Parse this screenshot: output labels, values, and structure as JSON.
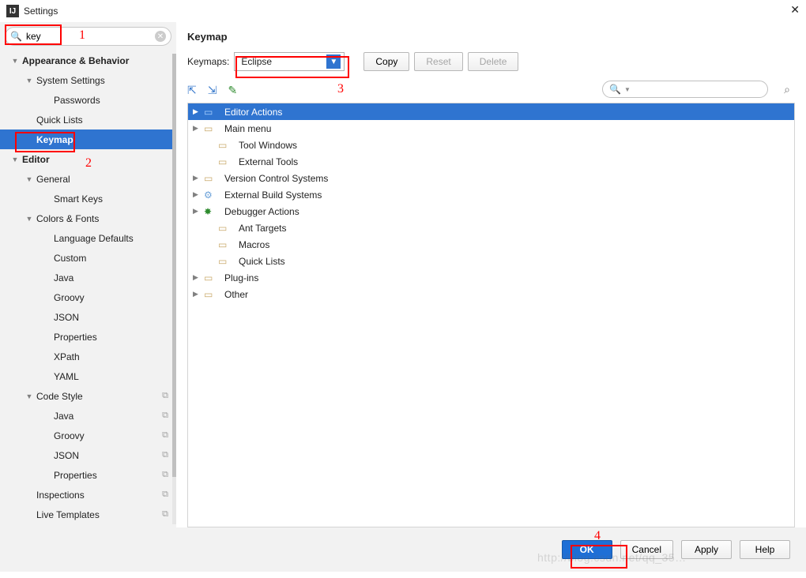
{
  "window": {
    "title": "Settings"
  },
  "search": {
    "value": "key"
  },
  "annotations": {
    "n1": "1",
    "n2": "2",
    "n3": "3",
    "n4": "4"
  },
  "sidebar": [
    {
      "label": "Appearance & Behavior",
      "level": 0,
      "arrow": "▼",
      "bold": true
    },
    {
      "label": "System Settings",
      "level": 1,
      "arrow": "▼"
    },
    {
      "label": "Passwords",
      "level": 2
    },
    {
      "label": "Quick Lists",
      "level": 1
    },
    {
      "label": "Keymap",
      "level": 1,
      "selected": true
    },
    {
      "label": "Editor",
      "level": 0,
      "arrow": "▼",
      "bold": true
    },
    {
      "label": "General",
      "level": 1,
      "arrow": "▼"
    },
    {
      "label": "Smart Keys",
      "level": 2
    },
    {
      "label": "Colors & Fonts",
      "level": 1,
      "arrow": "▼"
    },
    {
      "label": "Language Defaults",
      "level": 2
    },
    {
      "label": "Custom",
      "level": 2
    },
    {
      "label": "Java",
      "level": 2
    },
    {
      "label": "Groovy",
      "level": 2
    },
    {
      "label": "JSON",
      "level": 2
    },
    {
      "label": "Properties",
      "level": 2
    },
    {
      "label": "XPath",
      "level": 2
    },
    {
      "label": "YAML",
      "level": 2
    },
    {
      "label": "Code Style",
      "level": 1,
      "arrow": "▼",
      "copy": true
    },
    {
      "label": "Java",
      "level": 2,
      "copy": true
    },
    {
      "label": "Groovy",
      "level": 2,
      "copy": true
    },
    {
      "label": "JSON",
      "level": 2,
      "copy": true
    },
    {
      "label": "Properties",
      "level": 2,
      "copy": true
    },
    {
      "label": "Inspections",
      "level": 1,
      "copy": true
    },
    {
      "label": "Live Templates",
      "level": 1,
      "copy": true
    }
  ],
  "page": {
    "title": "Keymap",
    "keymaps_label": "Keymaps:",
    "selected_keymap": "Eclipse",
    "copy": "Copy",
    "reset": "Reset",
    "delete": "Delete"
  },
  "actions": [
    {
      "label": "Editor Actions",
      "arrow": "▶",
      "iconType": "folder",
      "selected": true
    },
    {
      "label": "Main menu",
      "arrow": "▶",
      "iconType": "folder"
    },
    {
      "label": "Tool Windows",
      "iconType": "folder",
      "indent": true
    },
    {
      "label": "External Tools",
      "iconType": "folder",
      "indent": true
    },
    {
      "label": "Version Control Systems",
      "arrow": "▶",
      "iconType": "folder"
    },
    {
      "label": "External Build Systems",
      "arrow": "▶",
      "iconType": "ext"
    },
    {
      "label": "Debugger Actions",
      "arrow": "▶",
      "iconType": "bug"
    },
    {
      "label": "Ant Targets",
      "iconType": "folder",
      "indent": true
    },
    {
      "label": "Macros",
      "iconType": "folder",
      "indent": true
    },
    {
      "label": "Quick Lists",
      "iconType": "folder",
      "indent": true
    },
    {
      "label": "Plug-ins",
      "arrow": "▶",
      "iconType": "folder"
    },
    {
      "label": "Other",
      "arrow": "▶",
      "iconType": "folder"
    }
  ],
  "footer": {
    "ok": "OK",
    "cancel": "Cancel",
    "apply": "Apply",
    "help": "Help"
  },
  "watermark": "http://blog.csdn.net/qq_35…"
}
